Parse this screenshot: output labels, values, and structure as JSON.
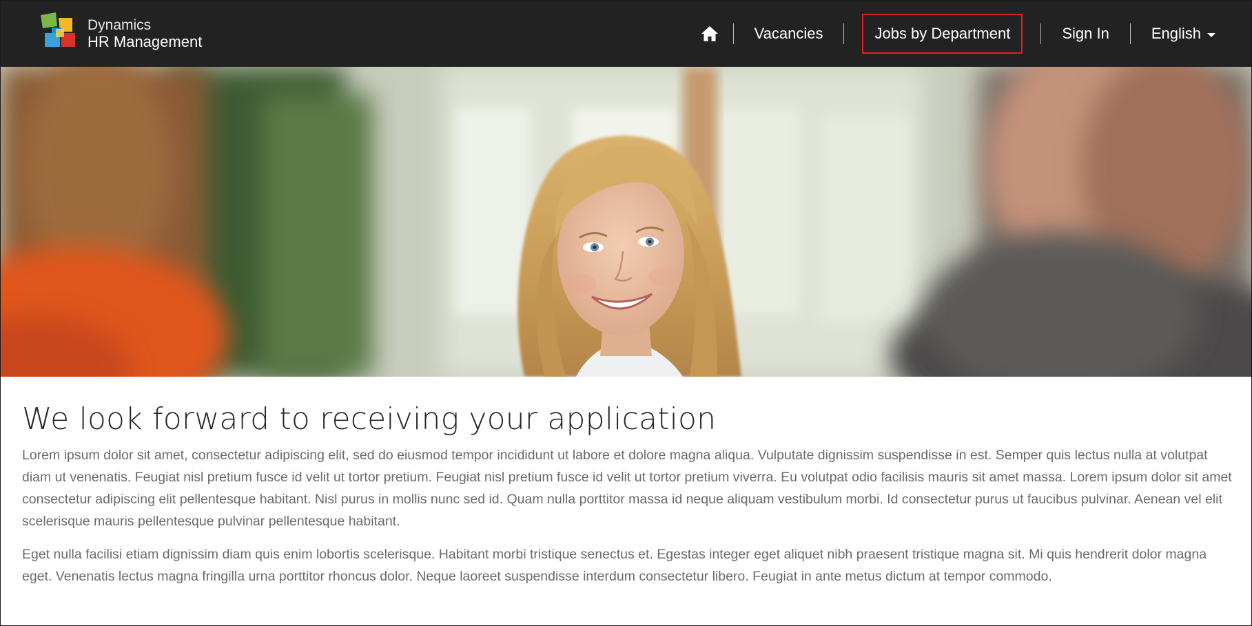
{
  "brand": {
    "line1": "Dynamics",
    "line2": "HR Management"
  },
  "nav": {
    "home_icon": "home-icon",
    "items": [
      {
        "label": "Vacancies"
      },
      {
        "label": "Jobs by Department"
      },
      {
        "label": "Sign In"
      }
    ],
    "language": {
      "label": "English",
      "icon": "caret-down-icon"
    }
  },
  "colors": {
    "header_bg": "#222222",
    "highlight_box": "#e01e26",
    "text_body": "#6a6a6a",
    "text_heading": "#262626"
  },
  "hero": {
    "icon": "hero-photo"
  },
  "main": {
    "headline": "We look forward to receiving your application",
    "paragraphs": [
      "Lorem ipsum dolor sit amet, consectetur adipiscing elit, sed do eiusmod tempor incididunt ut labore et dolore magna aliqua. Vulputate dignissim suspendisse in est. Semper quis lectus nulla at volutpat diam ut venenatis. Feugiat nisl pretium fusce id velit ut tortor pretium. Feugiat nisl pretium fusce id velit ut tortor pretium viverra. Eu volutpat odio facilisis mauris sit amet massa. Lorem ipsum dolor sit amet consectetur adipiscing elit pellentesque habitant. Nisl purus in mollis nunc sed id. Quam nulla porttitor massa id neque aliquam vestibulum morbi. Id consectetur purus ut faucibus pulvinar. Aenean vel elit scelerisque mauris pellentesque pulvinar pellentesque habitant.",
      "Eget nulla facilisi etiam dignissim diam quis enim lobortis scelerisque. Habitant morbi tristique senectus et. Egestas integer eget aliquet nibh praesent tristique magna sit. Mi quis hendrerit dolor magna eget. Venenatis lectus magna fringilla urna porttitor rhoncus dolor. Neque laoreet suspendisse interdum consectetur libero. Feugiat in ante metus dictum at tempor commodo."
    ]
  }
}
